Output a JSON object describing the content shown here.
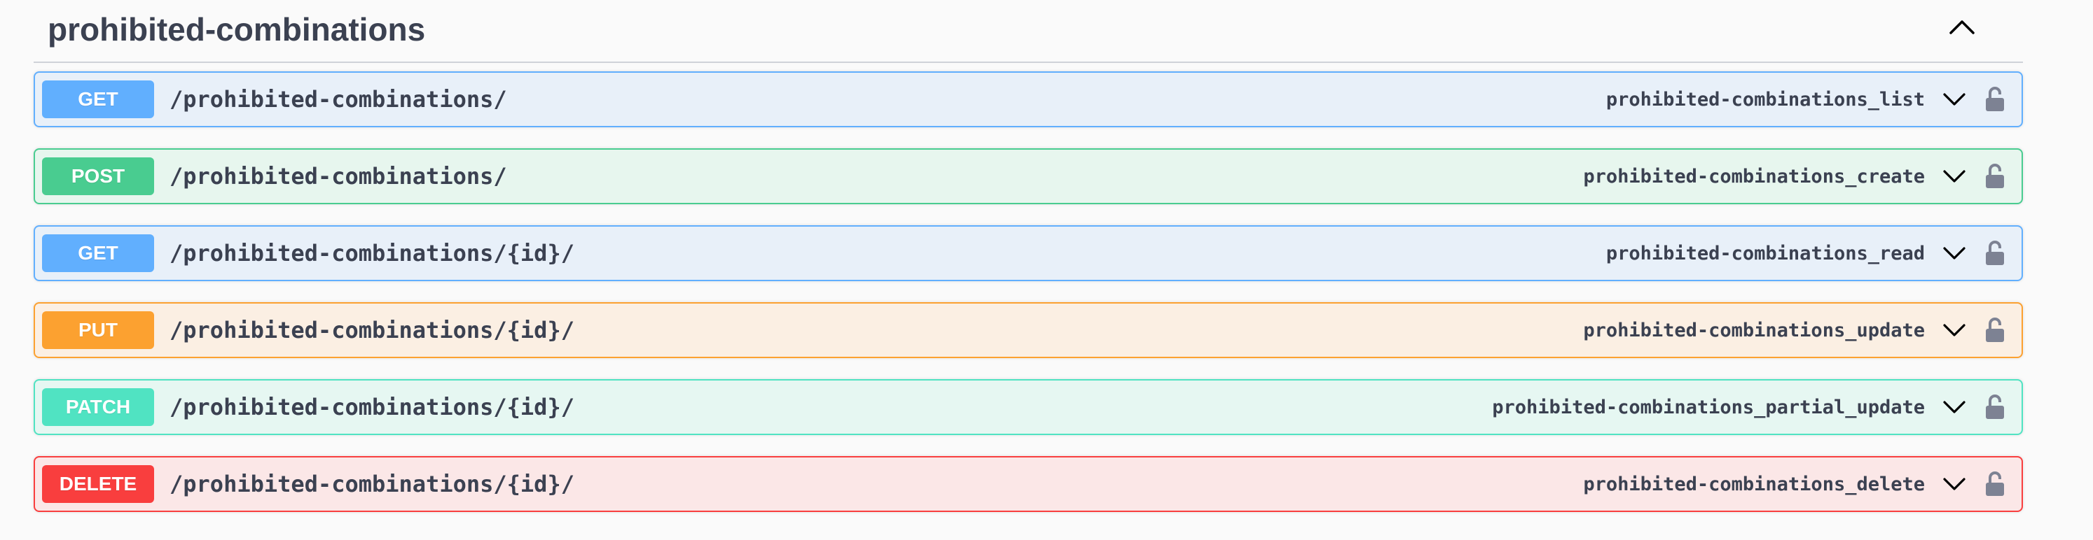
{
  "section": {
    "title": "prohibited-combinations",
    "toggle_icon": "chevron-up-icon"
  },
  "colors": {
    "get": "#61affe",
    "post": "#49cc90",
    "put": "#fca130",
    "patch": "#50e3c2",
    "delete": "#f93e3e",
    "text": "#3b4151"
  },
  "operations": [
    {
      "method": "GET",
      "path": "/prohibited-combinations/",
      "operation_id": "prohibited-combinations_list",
      "expand_icon": "chevron-down-icon",
      "auth_icon": "unlocked-padlock-icon"
    },
    {
      "method": "POST",
      "path": "/prohibited-combinations/",
      "operation_id": "prohibited-combinations_create",
      "expand_icon": "chevron-down-icon",
      "auth_icon": "unlocked-padlock-icon"
    },
    {
      "method": "GET",
      "path": "/prohibited-combinations/{id}/",
      "operation_id": "prohibited-combinations_read",
      "expand_icon": "chevron-down-icon",
      "auth_icon": "unlocked-padlock-icon"
    },
    {
      "method": "PUT",
      "path": "/prohibited-combinations/{id}/",
      "operation_id": "prohibited-combinations_update",
      "expand_icon": "chevron-down-icon",
      "auth_icon": "unlocked-padlock-icon"
    },
    {
      "method": "PATCH",
      "path": "/prohibited-combinations/{id}/",
      "operation_id": "prohibited-combinations_partial_update",
      "expand_icon": "chevron-down-icon",
      "auth_icon": "unlocked-padlock-icon"
    },
    {
      "method": "DELETE",
      "path": "/prohibited-combinations/{id}/",
      "operation_id": "prohibited-combinations_delete",
      "expand_icon": "chevron-down-icon",
      "auth_icon": "unlocked-padlock-icon"
    }
  ]
}
